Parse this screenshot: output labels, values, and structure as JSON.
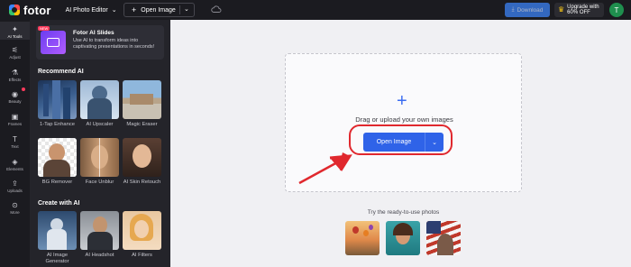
{
  "app": {
    "logo_text": "fotor",
    "editor_menu_label": "AI Photo Editor",
    "open_image_label": "Open Image",
    "download_label": "Download",
    "upgrade_line1": "Upgrade with",
    "upgrade_line2": "60% OFF",
    "avatar_initial": "T",
    "colors": {
      "topbar": "#1b1b20",
      "accent": "#2f63e8",
      "highlight": "#e0282e"
    }
  },
  "rail": {
    "items": [
      {
        "label": "AI Tools",
        "icon": "wand-icon",
        "active": true
      },
      {
        "label": "Adjust",
        "icon": "sliders-icon"
      },
      {
        "label": "Effects",
        "icon": "flask-icon"
      },
      {
        "label": "Beauty",
        "icon": "eye-icon",
        "dot": true
      },
      {
        "label": "Frames",
        "icon": "frame-icon"
      },
      {
        "label": "Text",
        "icon": "text-icon"
      },
      {
        "label": "Elements",
        "icon": "shapes-icon"
      },
      {
        "label": "Uploads",
        "icon": "upload-icon"
      },
      {
        "label": "More",
        "icon": "more-icon"
      }
    ]
  },
  "panel": {
    "promo": {
      "badge": "NEW",
      "title": "Fotor AI Slides",
      "description": "Use AI to transform ideas into captivating presentations in seconds!"
    },
    "recommend_title": "Recommend AI",
    "recommend_tools": [
      {
        "label": "1-Tap Enhance"
      },
      {
        "label": "AI Upscaler"
      },
      {
        "label": "Magic Eraser"
      },
      {
        "label": "BG Remover"
      },
      {
        "label": "Face Unblur"
      },
      {
        "label": "AI Skin Retouch"
      }
    ],
    "create_title": "Create with AI",
    "create_tools": [
      {
        "label": "AI Image Generator"
      },
      {
        "label": "AI Headshot"
      },
      {
        "label": "AI Filters"
      }
    ]
  },
  "canvas": {
    "drop_text": "Drag or upload your own images",
    "open_button_label": "Open Image",
    "ready_text": "Try the ready-to-use photos"
  }
}
